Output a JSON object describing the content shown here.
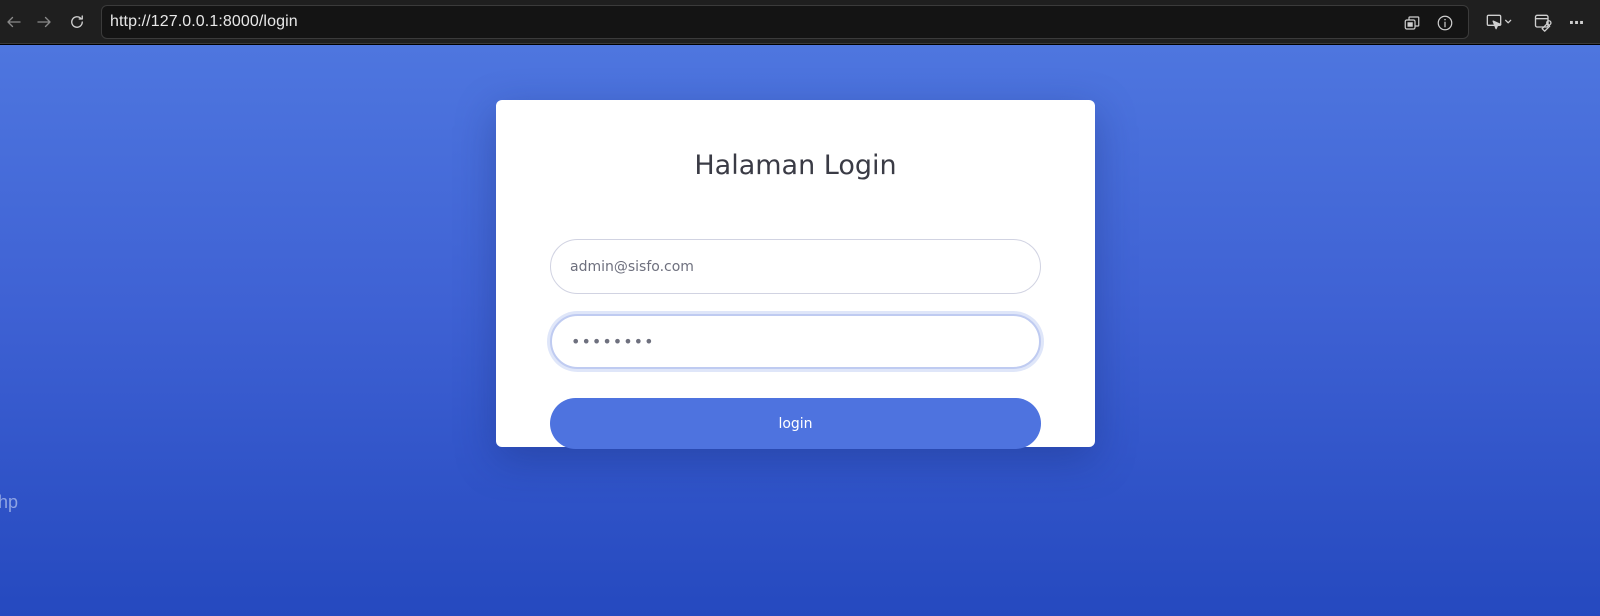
{
  "browser": {
    "url": "http://127.0.0.1:8000/login",
    "icons": {
      "back": "back-arrow-icon",
      "forward": "forward-arrow-icon",
      "refresh": "refresh-icon",
      "tabs": "tab-actions-icon",
      "info": "site-info-icon",
      "cast": "cast-icon",
      "extensions": "extensions-icon",
      "menu": "more-menu-icon"
    },
    "menu_glyph": "···"
  },
  "page": {
    "stray_text": "php",
    "colors": {
      "gradient_top": "#4e76df",
      "gradient_bottom": "#2549bf",
      "button": "#4e73df"
    }
  },
  "login": {
    "title": "Halaman Login",
    "email_value": "admin@sisfo.com",
    "password_value": "••••••••",
    "button_label": "login"
  }
}
